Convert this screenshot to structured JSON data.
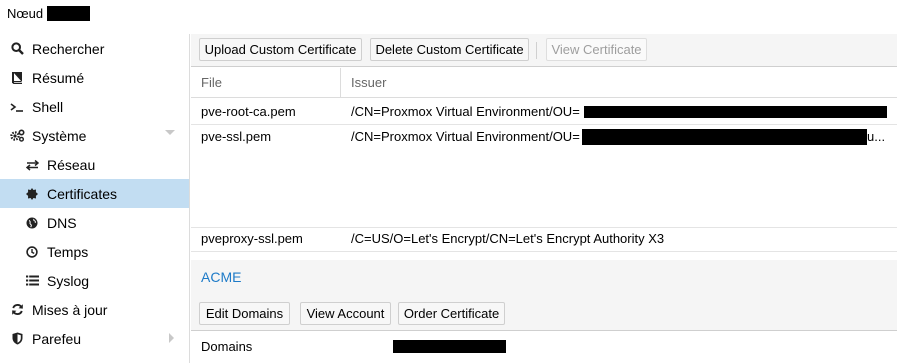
{
  "header": {
    "node_label": "Nœud"
  },
  "sidebar": {
    "items": [
      {
        "label": "Rechercher",
        "icon": "search-icon"
      },
      {
        "label": "Résumé",
        "icon": "book-icon"
      },
      {
        "label": "Shell",
        "icon": "terminal-icon"
      },
      {
        "label": "Système",
        "icon": "gears-icon"
      },
      {
        "label": "Réseau",
        "icon": "exchange-icon"
      },
      {
        "label": "Certificates",
        "icon": "certificate-icon"
      },
      {
        "label": "DNS",
        "icon": "globe-icon"
      },
      {
        "label": "Temps",
        "icon": "clock-icon"
      },
      {
        "label": "Syslog",
        "icon": "list-icon"
      },
      {
        "label": "Mises à jour",
        "icon": "refresh-icon"
      },
      {
        "label": "Parefeu",
        "icon": "shield-icon"
      }
    ]
  },
  "toolbar": {
    "upload_label": "Upload Custom Certificate",
    "delete_label": "Delete Custom Certificate",
    "view_label": "View Certificate"
  },
  "grid": {
    "columns": [
      "File",
      "Issuer"
    ],
    "rows": [
      {
        "file": "pve-root-ca.pem",
        "issuer": "/CN=Proxmox Virtual Environment/OU="
      },
      {
        "file": "pve-ssl.pem",
        "issuer": "/CN=Proxmox Virtual Environment/OU=",
        "suffix": "u..."
      },
      {
        "file": "pveproxy-ssl.pem",
        "issuer": "/C=US/O=Let's Encrypt/CN=Let's Encrypt Authority X3"
      }
    ]
  },
  "acme": {
    "title": "ACME",
    "edit_domains_label": "Edit Domains",
    "view_account_label": "View Account",
    "order_certificate_label": "Order Certificate",
    "domains_label": "Domains"
  },
  "colors": {
    "selected_bg": "#c2ddf2",
    "acme_title": "#1e7bc8"
  }
}
